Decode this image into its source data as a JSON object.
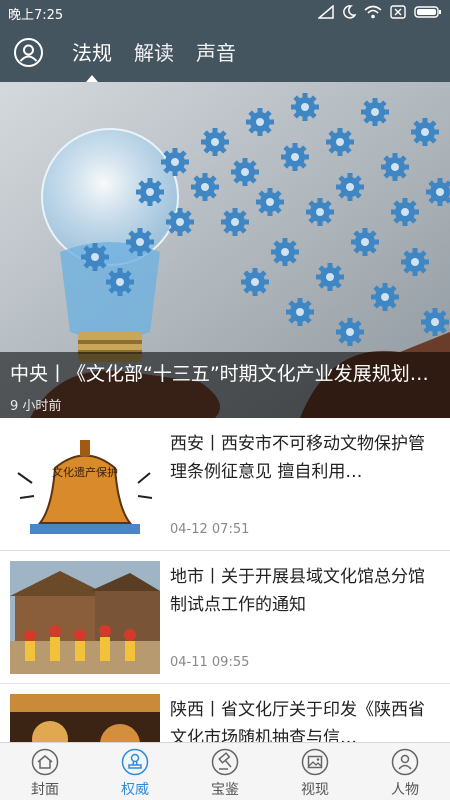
{
  "status": {
    "time": "晚上7:25"
  },
  "header": {
    "tabs": [
      {
        "label": "法规"
      },
      {
        "label": "解读"
      },
      {
        "label": "声音"
      }
    ]
  },
  "hero": {
    "title": "中央丨《文化部“十三五”时期文化产业发展规划…",
    "time": "9 小时前"
  },
  "news": [
    {
      "title": "西安丨西安市不可移动文物保护管理条例征意见 擅自利用…",
      "date": "04-12 07:51",
      "thumb_label": "文化遗产保护"
    },
    {
      "title": "地市丨关于开展县域文化馆总分馆制试点工作的通知",
      "date": "04-11 09:55"
    },
    {
      "title": "陕西丨省文化厅关于印发《陕西省文化市场随机抽查与信…",
      "date": ""
    }
  ],
  "bottom_nav": [
    {
      "label": "封面",
      "icon": "home-icon"
    },
    {
      "label": "权威",
      "icon": "stamp-icon"
    },
    {
      "label": "宝鉴",
      "icon": "gavel-icon"
    },
    {
      "label": "视现",
      "icon": "image-icon"
    },
    {
      "label": "人物",
      "icon": "person-icon"
    }
  ],
  "colors": {
    "header_bg": "#455560",
    "active_nav": "#2d8be0",
    "gear_blue": "#3f86c4"
  }
}
